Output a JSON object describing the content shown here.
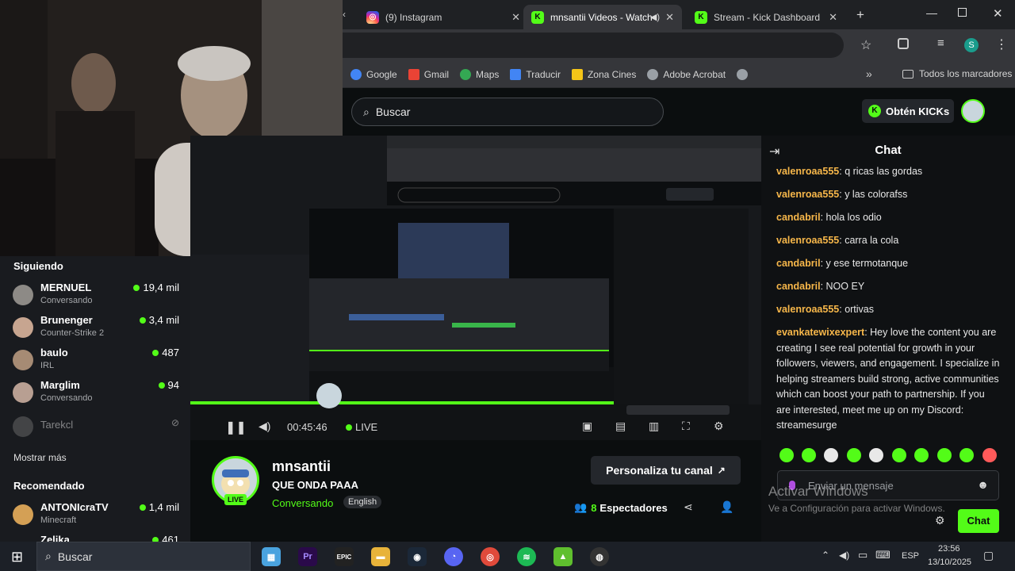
{
  "browser": {
    "tabs": [
      {
        "label": "(9) Instagram",
        "icon": "instagram-icon",
        "active": false
      },
      {
        "label": "mnsantii Videos - Watch",
        "icon": "kick-icon",
        "active": true
      },
      {
        "label": "Stream - Kick Dashboard",
        "icon": "kick-icon",
        "active": false
      }
    ],
    "new_tab": "+",
    "bookmarks": [
      {
        "label": "Google",
        "color": "#4285f4"
      },
      {
        "label": "Gmail",
        "color": "#ea4335"
      },
      {
        "label": "Maps",
        "color": "#34a853"
      },
      {
        "label": "Traducir",
        "color": "#4285f4"
      },
      {
        "label": "Zona Cines",
        "color": "#f5c518"
      },
      {
        "label": "Adobe Acrobat",
        "color": "#9aa0a6"
      }
    ],
    "all_bookmarks": "Todos los marcadores",
    "profile_initial": "S"
  },
  "kick": {
    "search_placeholder": "Buscar",
    "get_kicks": "Obtén KICKs",
    "sidebar": {
      "following_title": "Siguiendo",
      "following": [
        {
          "name": "MERNUEL",
          "sub": "Conversando",
          "viewers": "19,4 mil",
          "live": true
        },
        {
          "name": "Brunenger",
          "sub": "Counter-Strike 2",
          "viewers": "3,4 mil",
          "live": true
        },
        {
          "name": "baulo",
          "sub": "IRL",
          "viewers": "487",
          "live": true
        },
        {
          "name": "Marglim",
          "sub": "Conversando",
          "viewers": "94",
          "live": true
        },
        {
          "name": "Tarekcl",
          "sub": "",
          "viewers": "",
          "live": false
        }
      ],
      "show_more": "Mostrar más",
      "recommended_title": "Recomendado",
      "recommended": [
        {
          "name": "ANTONIcraTV",
          "sub": "Minecraft",
          "viewers": "1,4 mil",
          "live": true
        },
        {
          "name": "Zelika",
          "sub": "",
          "viewers": "461",
          "live": true
        }
      ]
    },
    "video": {
      "time": "00:45:46",
      "live_label": "LIVE"
    },
    "stream": {
      "channel": "mnsantii",
      "title": "QUE ONDA PAAA",
      "category": "Conversando",
      "language": "English",
      "live_badge": "LIVE",
      "customize": "Personaliza tu canal",
      "viewers_count": "8",
      "viewers_label": "Espectadores"
    },
    "chat": {
      "title": "Chat",
      "messages": [
        {
          "user": "valenroaa555",
          "text": "q ricas las gordas"
        },
        {
          "user": "valenroaa555",
          "text": "y las colorafss"
        },
        {
          "user": "candabril",
          "text": "hola los odio"
        },
        {
          "user": "valenroaa555",
          "text": "carra la cola"
        },
        {
          "user": "candabril",
          "text": "y ese termotanque"
        },
        {
          "user": "candabril",
          "text": "NOO EY"
        },
        {
          "user": "valenroaa555",
          "text": "ortivas"
        },
        {
          "user": "evankatewixexpert",
          "text": "Hey love the content you are creating I see real potential for growth in your followers, viewers, and engagement. I specialize in helping streamers build strong, active communities which can boost your path to partnership. If you are interested, meet me up on my Discord: streamesurge"
        }
      ],
      "input_placeholder": "Enviar un mensaje",
      "send_label": "Chat"
    }
  },
  "windows": {
    "activate_title": "Activar Windows",
    "activate_sub": "Ve a Configuración para activar Windows.",
    "search_label": "Buscar",
    "language": "ESP",
    "time": "23:56",
    "date": "13/10/2025"
  },
  "colors": {
    "kick_green": "#53fc18",
    "username_orange": "#f7b74a"
  }
}
